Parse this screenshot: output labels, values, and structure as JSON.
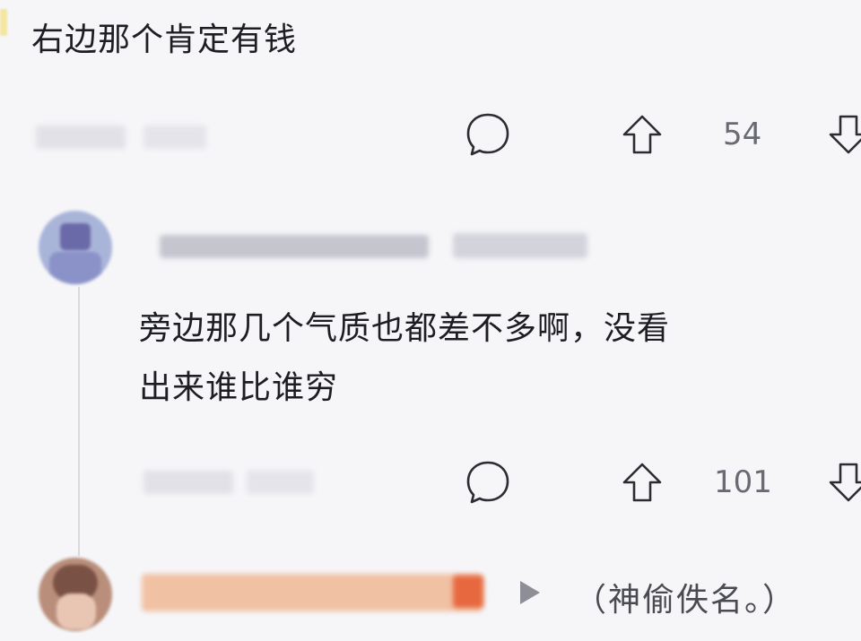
{
  "comment1": {
    "text": "右边那个肯定有钱",
    "likes": "54"
  },
  "comment2": {
    "text_line1": "旁边那几个气质也都差不多啊，没看",
    "text_line2": "出来谁比谁穷",
    "likes": "101"
  },
  "comment3": {
    "anonymous_note": "（神偷佚名。）"
  },
  "icons": {
    "comment": "comment-bubble-icon",
    "upvote": "thumb-up-arrow-icon",
    "downvote": "thumb-down-arrow-icon",
    "reply_to": "play-arrow-icon"
  },
  "colors": {
    "background": "#f6f6f9",
    "text": "#1d1d24",
    "muted": "#6a6a74",
    "blur_orange": "#f1a27a"
  }
}
